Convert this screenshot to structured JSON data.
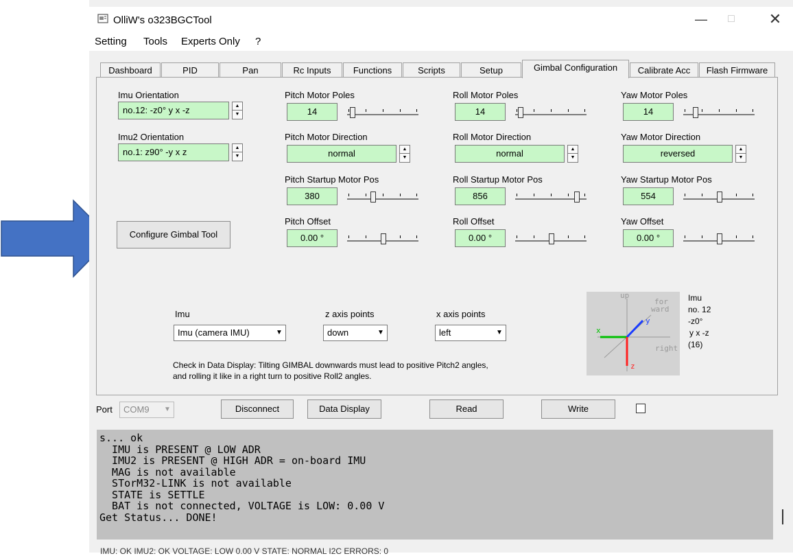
{
  "window": {
    "title": "OlliW's o323BGCTool"
  },
  "menu": [
    "Setting",
    "Tools",
    "Experts Only",
    "?"
  ],
  "tabs": [
    "Dashboard",
    "PID",
    "Pan",
    "Rc Inputs",
    "Functions",
    "Scripts",
    "Setup",
    "Gimbal Configuration",
    "Calibrate Acc",
    "Flash Firmware"
  ],
  "active_tab": "Gimbal Configuration",
  "imu": {
    "orientation_label": "Imu Orientation",
    "orientation_value": "no.12:  -z0°  y x -z",
    "imu2_label": "Imu2 Orientation",
    "imu2_value": "no.1:  z90°  -y x z"
  },
  "pitch": {
    "poles_label": "Pitch Motor Poles",
    "poles": "14",
    "dir_label": "Pitch Motor Direction",
    "dir": "normal",
    "startup_label": "Pitch Startup Motor Pos",
    "startup": "380",
    "offset_label": "Pitch Offset",
    "offset": "0.00 °"
  },
  "roll": {
    "poles_label": "Roll Motor Poles",
    "poles": "14",
    "dir_label": "Roll Motor Direction",
    "dir": "normal",
    "startup_label": "Roll Startup Motor Pos",
    "startup": "856",
    "offset_label": "Roll Offset",
    "offset": "0.00 °"
  },
  "yaw": {
    "poles_label": "Yaw Motor Poles",
    "poles": "14",
    "dir_label": "Yaw Motor Direction",
    "dir": "reversed",
    "startup_label": "Yaw Startup Motor Pos",
    "startup": "554",
    "offset_label": "Yaw Offset",
    "offset": "0.00 °"
  },
  "configure_button": "Configure Gimbal Tool",
  "tool": {
    "imu_label": "Imu",
    "imu_value": "Imu  (camera IMU)",
    "z_label": "z axis points",
    "z_value": "down",
    "x_label": "x axis points",
    "x_value": "left",
    "hint_line1": "Check in Data Display: Tilting GIMBAL downwards must lead to positive Pitch2 angles,",
    "hint_line2": "and rolling it like in a right turn to positive Roll2 angles."
  },
  "imu_view": {
    "up": "up",
    "for": "for",
    "ward": "ward",
    "right": "right",
    "x": "x",
    "y": "y",
    "z": "z",
    "info_title": "Imu",
    "info_no": "no. 12",
    "info_angle": "-z0°",
    "info_axes": "y  x -z",
    "info_code": "(16)",
    "colors": {
      "x": "#00c000",
      "y": "#1a3cff",
      "z": "#ff2020"
    }
  },
  "bottom": {
    "port_label": "Port",
    "port_value": "COM9",
    "disconnect": "Disconnect",
    "data_display": "Data Display",
    "read": "Read",
    "write": "Write"
  },
  "console": [
    "s... ok",
    "  IMU is PRESENT @ LOW ADR",
    "  IMU2 is PRESENT @ HIGH ADR = on-board IMU",
    "  MAG is not available",
    "  STorM32-LINK is not available",
    "  STATE is SETTLE",
    "  BAT is not connected, VOLTAGE is LOW: 0.00 V",
    "Get Status... DONE!"
  ],
  "status_bar": "IMU: OK    IMU2: OK    VOLTAGE: LOW 0.00 V    STATE: NORMAL    I2C ERRORS: 0",
  "annotation": {
    "arrow_color": "#4472c4"
  }
}
